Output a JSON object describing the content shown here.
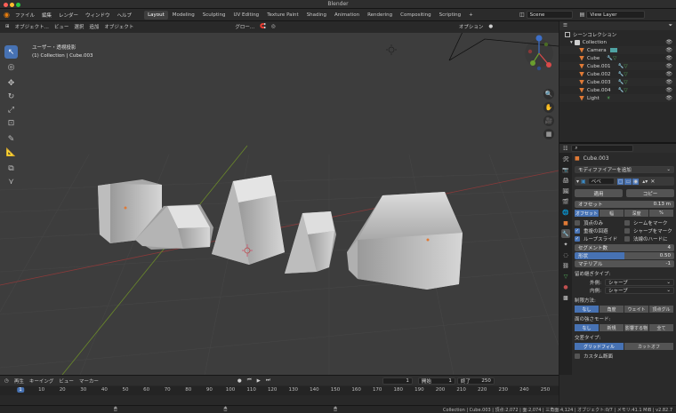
{
  "window": {
    "title": "Blender"
  },
  "topbar": {
    "menus": [
      "ファイル",
      "編集",
      "レンダー",
      "ウィンドウ",
      "ヘルプ"
    ],
    "workspaces": [
      "Layout",
      "Modeling",
      "Sculpting",
      "UV Editing",
      "Texture Paint",
      "Shading",
      "Animation",
      "Rendering",
      "Compositing",
      "Scripting"
    ],
    "active_workspace": "Layout",
    "add_tab": "+",
    "scene": "Scene",
    "view_layer": "View Layer"
  },
  "viewport": {
    "header": {
      "mode": "オブジェクト...",
      "view": "ビュー",
      "select": "選択",
      "add": "追加",
      "object": "オブジェクト",
      "transform": "グロー...",
      "options": "オプション"
    },
    "overlay": {
      "projection": "ユーザー・透視投影",
      "context": "(1) Collection | Cube.003"
    },
    "gizmo": {
      "x": "X",
      "y": "Y",
      "z": "Z"
    }
  },
  "outliner": {
    "title": "シーンコレクション",
    "items": [
      {
        "name": "Collection",
        "color": "#e0e0e0",
        "indent": 0
      },
      {
        "name": "Camera",
        "color": "#e07a36",
        "indent": 1
      },
      {
        "name": "Cube",
        "color": "#e07a36",
        "indent": 1
      },
      {
        "name": "Cube.001",
        "color": "#e07a36",
        "indent": 1
      },
      {
        "name": "Cube.002",
        "color": "#e07a36",
        "indent": 1
      },
      {
        "name": "Cube.003",
        "color": "#e07a36",
        "indent": 1
      },
      {
        "name": "Cube.004",
        "color": "#e07a36",
        "indent": 1
      },
      {
        "name": "Light",
        "color": "#e07a36",
        "indent": 1
      }
    ]
  },
  "properties": {
    "object_name": "Cube.003",
    "add_modifier": "モディファイアーを追加",
    "modifier_name": "ベベ",
    "apply": "適用",
    "copy": "コピー",
    "offset_label": "オフセット",
    "offset_value": "0.13 m",
    "width_type": [
      "オフセット",
      "幅",
      "深度",
      "%"
    ],
    "checks": [
      {
        "label": "頂点のみ",
        "on": false
      },
      {
        "label": "シームをマーク",
        "on": false
      },
      {
        "label": "重複の回避",
        "on": true
      },
      {
        "label": "シャープをマーク",
        "on": false
      },
      {
        "label": "ループスライド",
        "on": true
      },
      {
        "label": "法線のハードに",
        "on": false
      }
    ],
    "segments_label": "セグメント数",
    "segments_value": "4",
    "profile_label": "形状",
    "profile_value": "0.50",
    "profile_fraction": 0.5,
    "material_label": "マテリアル",
    "material_value": "-1",
    "miter_label": "留め継ぎタイプ:",
    "outer_label": "外側:",
    "outer_value": "シャープ",
    "inner_label": "内側:",
    "inner_value": "シャープ",
    "limit_label": "制限方法:",
    "limit_options": [
      "なし",
      "角度",
      "ウェイト",
      "頂点グル"
    ],
    "face_mode_label": "面の強さモード:",
    "face_mode_options": [
      "なし",
      "新規",
      "影響する物",
      "全て"
    ],
    "intersect_label": "交差タイプ:",
    "intersect_options": [
      "グリッドフィル",
      "カットオフ"
    ],
    "custom_profile": "カスタム断面"
  },
  "timeline": {
    "menus": [
      "再生",
      "キーイング",
      "ビュー",
      "マーカー"
    ],
    "current_frame": "1",
    "start_label": "開始",
    "start_value": "1",
    "end_label": "終了",
    "end_value": "250",
    "ticks": [
      "1",
      "10",
      "20",
      "30",
      "40",
      "50",
      "60",
      "70",
      "80",
      "90",
      "100",
      "110",
      "120",
      "130",
      "140",
      "150",
      "160",
      "170",
      "180",
      "190",
      "200",
      "210",
      "220",
      "230",
      "240",
      "250"
    ]
  },
  "status": {
    "text": "Collection | Cube.003 | 頂点:2,072 | 面:2,074 | 三角面:4,124 | オブジェクト:0/7 | メモリ:41.1 MiB | v2.82.7"
  },
  "colors": {
    "accent": "#4772b3",
    "object_orange": "#e07a36",
    "vertex_green": "#54b05c",
    "modifier_blue": "#3b8ac4"
  }
}
